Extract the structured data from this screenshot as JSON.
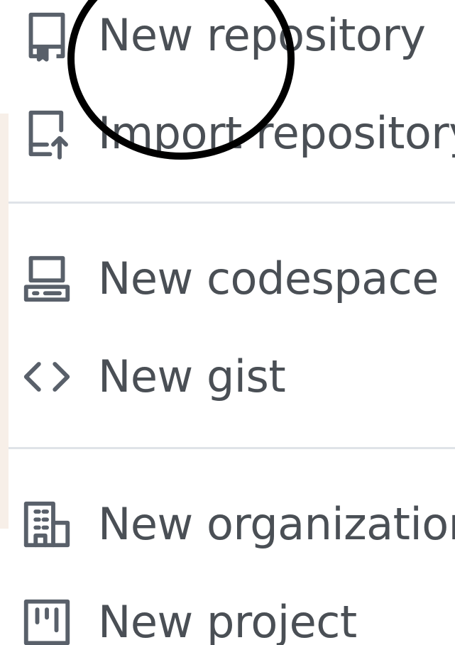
{
  "menu": {
    "items": [
      {
        "id": "new-repository",
        "label": "New repository",
        "icon": "repo-icon"
      },
      {
        "id": "import-repository",
        "label": "Import repository",
        "icon": "repo-push-icon"
      },
      {
        "id": "new-codespace",
        "label": "New codespace",
        "icon": "codespaces-icon"
      },
      {
        "id": "new-gist",
        "label": "New gist",
        "icon": "code-icon"
      },
      {
        "id": "new-organization",
        "label": "New organization",
        "icon": "organization-icon"
      },
      {
        "id": "new-project",
        "label": "New project",
        "icon": "project-icon"
      }
    ]
  },
  "colors": {
    "text": "#4a4f55",
    "icon": "#59606a",
    "divider": "#dfe3e8",
    "side_strip": "#f7efe8",
    "annotation": "#000000"
  }
}
